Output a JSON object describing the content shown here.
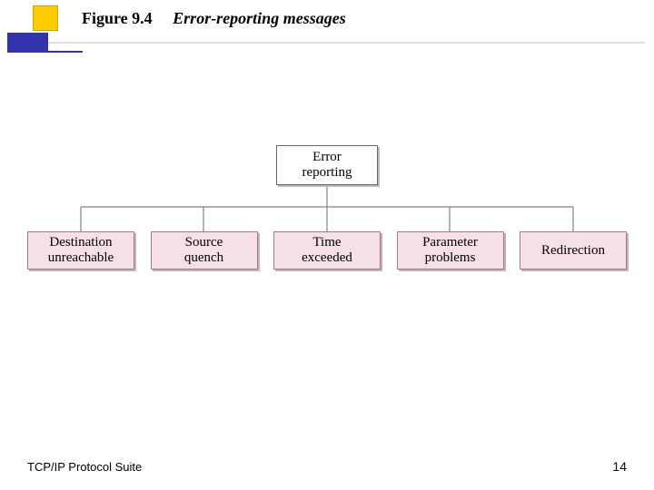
{
  "title": {
    "figure_label": "Figure 9.4",
    "caption": "Error-reporting messages"
  },
  "chart_data": {
    "type": "tree",
    "root": {
      "label": "Error\nreporting"
    },
    "children": [
      {
        "label": "Destination\nunreachable"
      },
      {
        "label": "Source\nquench"
      },
      {
        "label": "Time\nexceeded"
      },
      {
        "label": "Parameter\nproblems"
      },
      {
        "label": "Redirection"
      }
    ],
    "colors": {
      "root_fill": "#ffffff",
      "child_fill": "#f5dfe8",
      "line": "#808080"
    }
  },
  "footer": {
    "left": "TCP/IP Protocol Suite",
    "page_number": "14"
  }
}
